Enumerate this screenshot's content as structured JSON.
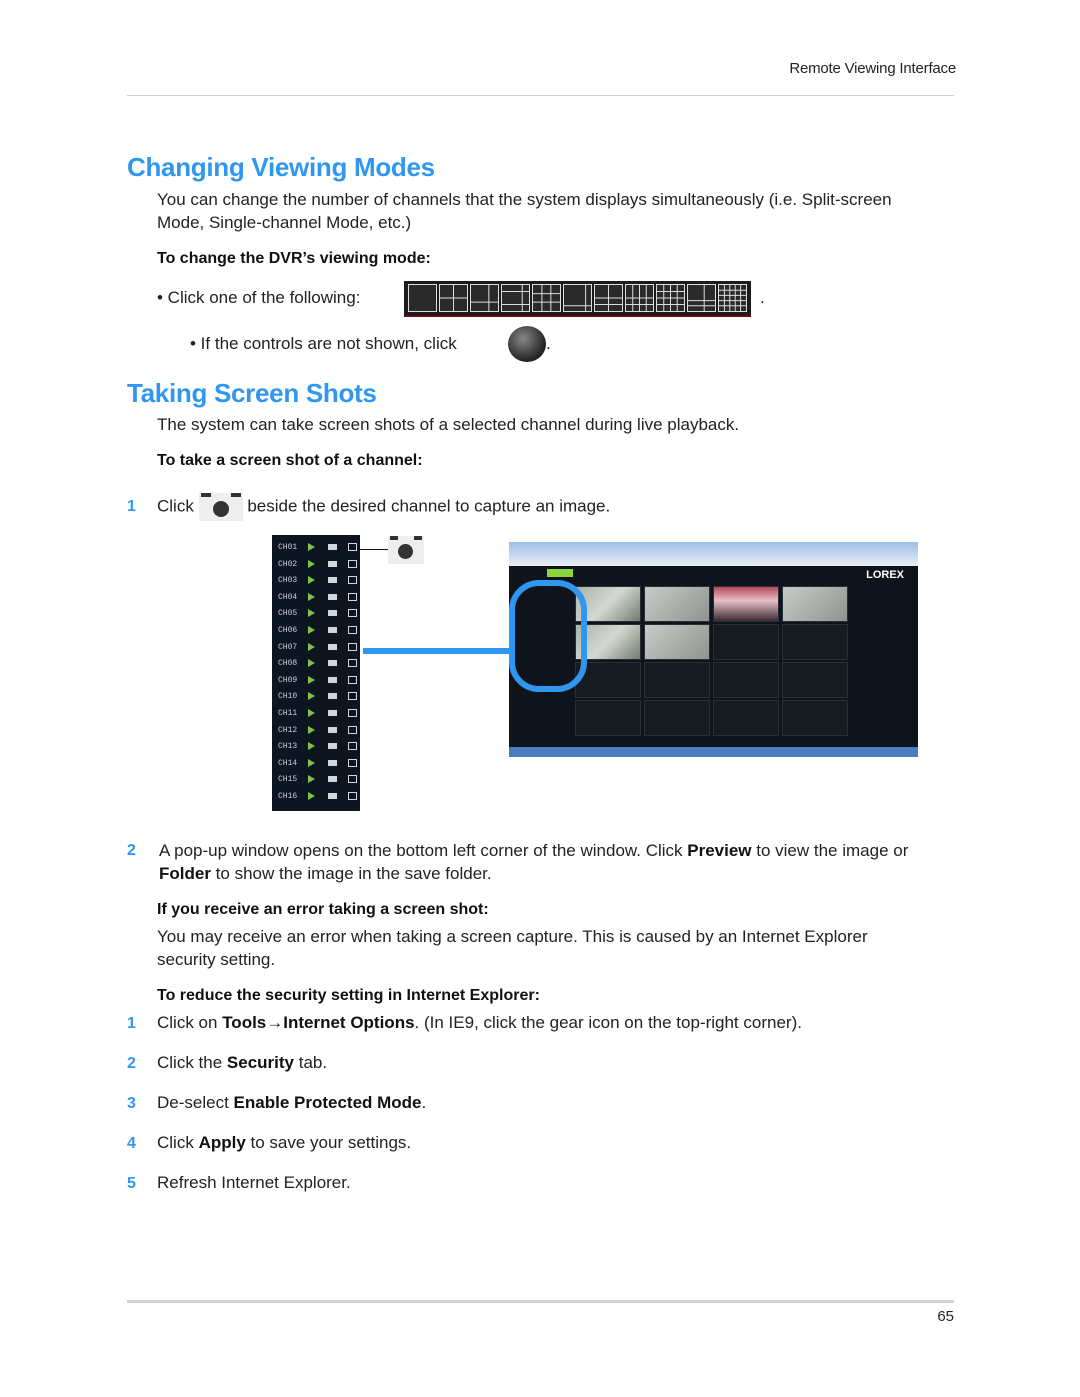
{
  "header": {
    "section_title": "Remote Viewing Interface"
  },
  "footer": {
    "page_number": "65"
  },
  "section1": {
    "title": "Changing Viewing Modes",
    "intro": "You can change the number of channels that the system displays simultaneously (i.e. Split-screen Mode, Single-channel Mode, etc.)",
    "subheading": "To change the DVR’s viewing mode:",
    "bullet1_prefix": "• Click one of the following:",
    "bullet1_suffix": ".",
    "bullet2_prefix": "• If the controls are not shown, click",
    "bullet2_suffix": ".",
    "mode_icons": [
      "1-split",
      "4-split",
      "6-split",
      "8-split",
      "9-split",
      "10-split",
      "13-split",
      "16-split-a",
      "16-split-b",
      "19-split",
      "25-split"
    ]
  },
  "section2": {
    "title": "Taking Screen Shots",
    "intro": "The system can take screen shots of a selected channel during live playback.",
    "subheading": "To take a screen shot of a channel:",
    "step1": {
      "num": "1",
      "prefix": "Click",
      "suffix": "beside the desired channel to capture an image."
    },
    "channels": [
      "CH01",
      "CH02",
      "CH03",
      "CH04",
      "CH05",
      "CH06",
      "CH07",
      "CH08",
      "CH09",
      "CH10",
      "CH11",
      "CH12",
      "CH13",
      "CH14",
      "CH15",
      "CH16"
    ],
    "screenshot_brand": "LOREX",
    "step2": {
      "num": "2",
      "t1": "A pop-up window opens on the bottom left corner of the window. Click ",
      "b1": "Preview",
      "t2": " to view the image or ",
      "b2": "Folder",
      "t3": " to show the image in the save folder."
    },
    "error_heading": "If you receive an error taking a screen shot:",
    "error_text": "You may receive an error when taking a screen capture. This is caused by an Internet Explorer security setting.",
    "reduce_heading": "To reduce the security setting in Internet Explorer:",
    "steps": [
      {
        "num": "1",
        "t1": "Click on ",
        "b1": "Tools→Internet Options",
        "t2": ". (In IE9, click the gear icon on the top-right corner)."
      },
      {
        "num": "2",
        "t1": "Click the ",
        "b1": "Security",
        "t2": " tab."
      },
      {
        "num": "3",
        "t1": "De-select ",
        "b1": "Enable Protected Mode",
        "t2": "."
      },
      {
        "num": "4",
        "t1": "Click ",
        "b1": "Apply",
        "t2": " to save your settings."
      },
      {
        "num": "5",
        "t1": "Refresh Internet Explorer.",
        "b1": "",
        "t2": ""
      }
    ]
  },
  "colors": {
    "accent": "#2f97f0",
    "text": "#222222"
  }
}
